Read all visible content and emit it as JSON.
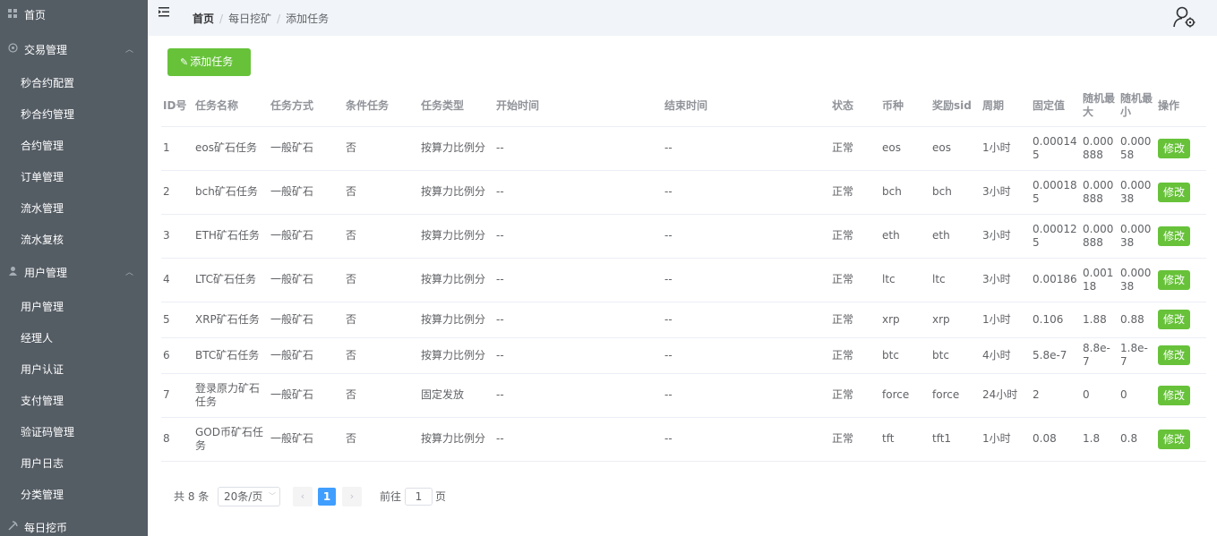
{
  "sidebar": {
    "home": "首页",
    "groups": [
      {
        "label": "交易管理",
        "items": [
          "秒合约配置",
          "秒合约管理",
          "合约管理",
          "订单管理",
          "流水管理",
          "流水复核"
        ]
      },
      {
        "label": "用户管理",
        "items": [
          "用户管理",
          "经理人",
          "用户认证",
          "支付管理",
          "验证码管理",
          "用户日志",
          "分类管理"
        ]
      },
      {
        "label": "每日挖币",
        "items": []
      }
    ]
  },
  "breadcrumb": {
    "home": "首页",
    "level1": "每日挖矿",
    "level2": "添加任务"
  },
  "toolbar": {
    "add_label": "添加任务"
  },
  "table": {
    "headers": [
      "ID号",
      "任务名称",
      "任务方式",
      "条件任务",
      "任务类型",
      "开始时间",
      "结束时间",
      "状态",
      "币种",
      "奖励sid",
      "周期",
      "固定值",
      "随机最大",
      "随机最小",
      "操作"
    ],
    "rows": [
      {
        "id": "1",
        "name": "eos矿石任务",
        "mode": "一般矿石",
        "cond": "否",
        "type": "按算力比例分",
        "start": "--",
        "end": "--",
        "status": "正常",
        "coin": "eos",
        "sid": "eos",
        "period": "1小时",
        "fixed": "0.000145",
        "rmax": "0.000888",
        "rmin": "0.00058",
        "action": "修改"
      },
      {
        "id": "2",
        "name": "bch矿石任务",
        "mode": "一般矿石",
        "cond": "否",
        "type": "按算力比例分",
        "start": "--",
        "end": "--",
        "status": "正常",
        "coin": "bch",
        "sid": "bch",
        "period": "3小时",
        "fixed": "0.000185",
        "rmax": "0.000888",
        "rmin": "0.00038",
        "action": "修改"
      },
      {
        "id": "3",
        "name": "ETH矿石任务",
        "mode": "一般矿石",
        "cond": "否",
        "type": "按算力比例分",
        "start": "--",
        "end": "--",
        "status": "正常",
        "coin": "eth",
        "sid": "eth",
        "period": "3小时",
        "fixed": "0.000125",
        "rmax": "0.000888",
        "rmin": "0.00038",
        "action": "修改"
      },
      {
        "id": "4",
        "name": "LTC矿石任务",
        "mode": "一般矿石",
        "cond": "否",
        "type": "按算力比例分",
        "start": "--",
        "end": "--",
        "status": "正常",
        "coin": "ltc",
        "sid": "ltc",
        "period": "3小时",
        "fixed": "0.00186",
        "rmax": "0.00118",
        "rmin": "0.00038",
        "action": "修改"
      },
      {
        "id": "5",
        "name": "XRP矿石任务",
        "mode": "一般矿石",
        "cond": "否",
        "type": "按算力比例分",
        "start": "--",
        "end": "--",
        "status": "正常",
        "coin": "xrp",
        "sid": "xrp",
        "period": "1小时",
        "fixed": "0.106",
        "rmax": "1.88",
        "rmin": "0.88",
        "action": "修改"
      },
      {
        "id": "6",
        "name": "BTC矿石任务",
        "mode": "一般矿石",
        "cond": "否",
        "type": "按算力比例分",
        "start": "--",
        "end": "--",
        "status": "正常",
        "coin": "btc",
        "sid": "btc",
        "period": "4小时",
        "fixed": "5.8e-7",
        "rmax": "8.8e-7",
        "rmin": "1.8e-7",
        "action": "修改"
      },
      {
        "id": "7",
        "name": "登录原力矿石任务",
        "mode": "一般矿石",
        "cond": "否",
        "type": "固定发放",
        "start": "--",
        "end": "--",
        "status": "正常",
        "coin": "force",
        "sid": "force",
        "period": "24小时",
        "fixed": "2",
        "rmax": "0",
        "rmin": "0",
        "action": "修改"
      },
      {
        "id": "8",
        "name": "GOD币矿石任务",
        "mode": "一般矿石",
        "cond": "否",
        "type": "按算力比例分",
        "start": "--",
        "end": "--",
        "status": "正常",
        "coin": "tft",
        "sid": "tft1",
        "period": "1小时",
        "fixed": "0.08",
        "rmax": "1.8",
        "rmin": "0.8",
        "action": "修改"
      }
    ]
  },
  "pagination": {
    "total": "共 8 条",
    "page_size": "20条/页",
    "current_page": "1",
    "goto_label": "前往",
    "goto_value": "1",
    "page_suffix": "页"
  },
  "colors": {
    "sidebar_bg": "#545c64",
    "accent_green": "#67c23a",
    "page_active": "#409eff"
  }
}
